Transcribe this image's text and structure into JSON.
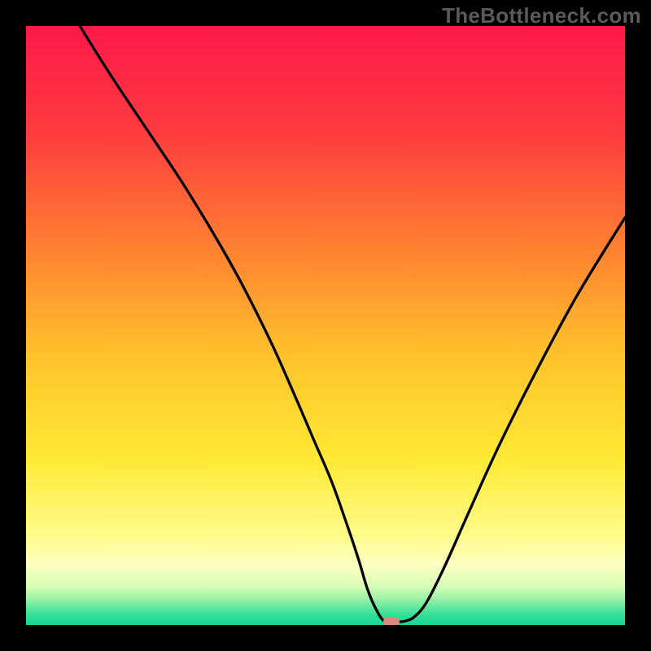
{
  "watermark": "TheBottleneck.com",
  "colors": {
    "frame": "#000000",
    "watermark": "#5a5a5a",
    "curve": "#000000",
    "marker": "#d9877f",
    "gradient_stops": [
      {
        "pos": 0.0,
        "color": "#ff194a"
      },
      {
        "pos": 0.18,
        "color": "#ff3c3f"
      },
      {
        "pos": 0.38,
        "color": "#ff8430"
      },
      {
        "pos": 0.55,
        "color": "#ffc22c"
      },
      {
        "pos": 0.72,
        "color": "#ffe933"
      },
      {
        "pos": 0.85,
        "color": "#fffc8a"
      },
      {
        "pos": 0.9,
        "color": "#fdffc2"
      },
      {
        "pos": 0.935,
        "color": "#d8ffb6"
      },
      {
        "pos": 0.955,
        "color": "#9ff3a9"
      },
      {
        "pos": 0.972,
        "color": "#5ce79c"
      },
      {
        "pos": 0.985,
        "color": "#2edc96"
      },
      {
        "pos": 1.0,
        "color": "#17d794"
      }
    ]
  },
  "chart_data": {
    "type": "line",
    "title": "",
    "xlabel": "",
    "ylabel": "",
    "xlim": [
      0,
      100
    ],
    "ylim": [
      0,
      100
    ],
    "grid": false,
    "series": [
      {
        "name": "bottleneck-curve",
        "x": [
          9,
          14,
          20,
          26,
          31.5,
          36,
          41,
          45,
          48,
          51,
          53.5,
          55.5,
          57,
          58.5,
          60,
          62,
          63.5,
          65,
          67,
          70,
          74,
          79,
          85,
          92,
          100
        ],
        "y": [
          100,
          92,
          83,
          74,
          65,
          57,
          47,
          38,
          31,
          24,
          17,
          11,
          6,
          2.5,
          0.5,
          0.5,
          0.7,
          1.5,
          4,
          10,
          19,
          30,
          42,
          55,
          68
        ]
      }
    ],
    "annotations": [
      {
        "name": "optimal-marker",
        "x": 61,
        "y": 0.5
      }
    ]
  }
}
